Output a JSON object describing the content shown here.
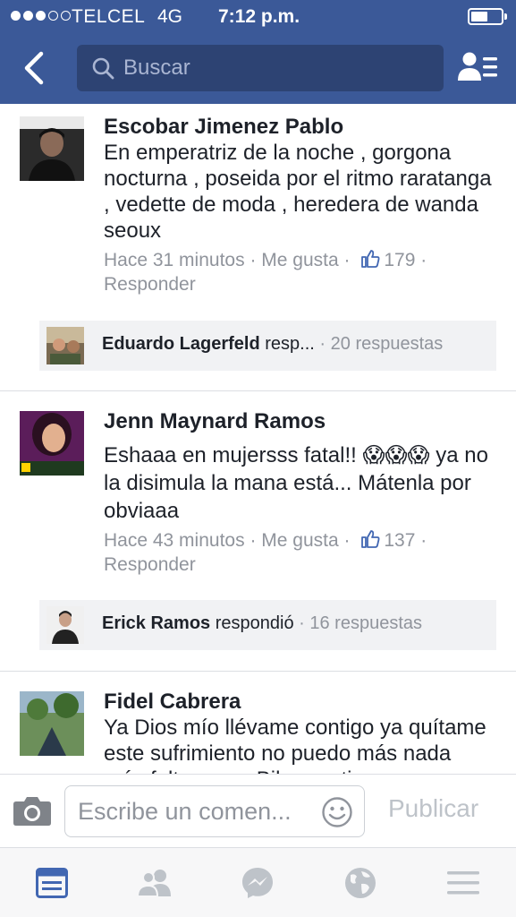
{
  "status_bar": {
    "carrier": "TELCEL",
    "network": "4G",
    "time": "7:12 p.m."
  },
  "header": {
    "search_placeholder": "Buscar"
  },
  "comments": [
    {
      "name": "Escobar Jimenez Pablo",
      "text": "En emperatriz de la noche , gorgona nocturna , poseida por el ritmo raratanga , vedette de moda , heredera de wanda seoux",
      "time": "Hace 31 minutos",
      "like_label": "Me gusta",
      "likes": "179",
      "reply_label": "Responder",
      "reply_preview": {
        "name": "Eduardo Lagerfeld",
        "action": "resp...",
        "count": "20 respuestas"
      }
    },
    {
      "name": "Jenn Maynard Ramos",
      "text": "Eshaaa en mujersss fatal!! 😱😱😱 ya no la disimula la mana está... Mátenla por obviaaa",
      "time": "Hace 43 minutos",
      "like_label": "Me gusta",
      "likes": "137",
      "reply_label": "Responder",
      "reply_preview": {
        "name": "Erick Ramos",
        "action": "respondió",
        "count": "16 respuestas"
      }
    },
    {
      "name": "Fidel Cabrera",
      "text": "Ya Dios mío llévame contigo ya quítame este sufrimiento no puedo más nada más falta que a Biby martin"
    }
  ],
  "separator": "·",
  "composer": {
    "placeholder": "Escribe un comen...",
    "publish_label": "Publicar"
  },
  "tabbar": [
    "news-feed-icon",
    "friend-requests-icon",
    "messenger-icon",
    "notifications-globe-icon",
    "menu-icon"
  ],
  "colors": {
    "brand": "#3b5998",
    "search_bg": "#2d4373",
    "meta_text": "#90949c",
    "active_tab": "#4267b2",
    "inactive_tab": "#bec3c9"
  }
}
